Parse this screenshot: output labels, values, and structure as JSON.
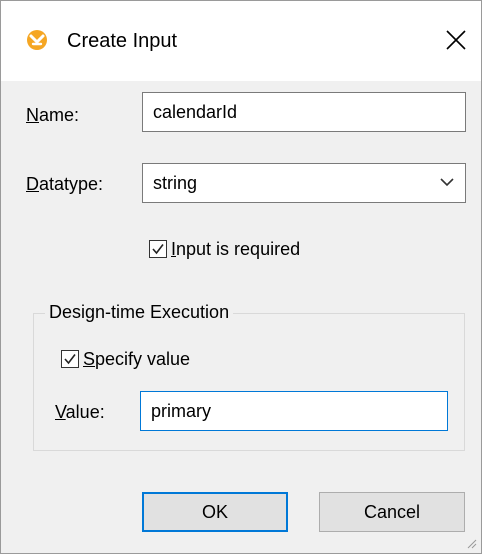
{
  "dialog": {
    "title": "Create Input",
    "close_glyph": "✕"
  },
  "form": {
    "name_label_mnemonic": "N",
    "name_label_rest": "ame:",
    "name_value": "calendarId",
    "datatype_label_mnemonic": "D",
    "datatype_label_rest": "atatype:",
    "datatype_value": "string",
    "required_mnemonic": "I",
    "required_rest": "nput is required",
    "required_checked": true
  },
  "design_time": {
    "group_title": "Design-time Execution",
    "specify_mnemonic": "S",
    "specify_rest": "pecify value",
    "specify_checked": true,
    "value_label_mnemonic": "V",
    "value_label_rest": "alue:",
    "value": "primary"
  },
  "buttons": {
    "ok": "OK",
    "cancel": "Cancel"
  },
  "icons": {
    "app": "mapforce-app-icon",
    "close": "close-icon",
    "dropdown": "chevron-down-icon",
    "check": "checkmark-icon"
  },
  "colors": {
    "accent": "#0078d7",
    "app_icon": "#f5a623",
    "dialog_bg": "#f0f0f0"
  }
}
